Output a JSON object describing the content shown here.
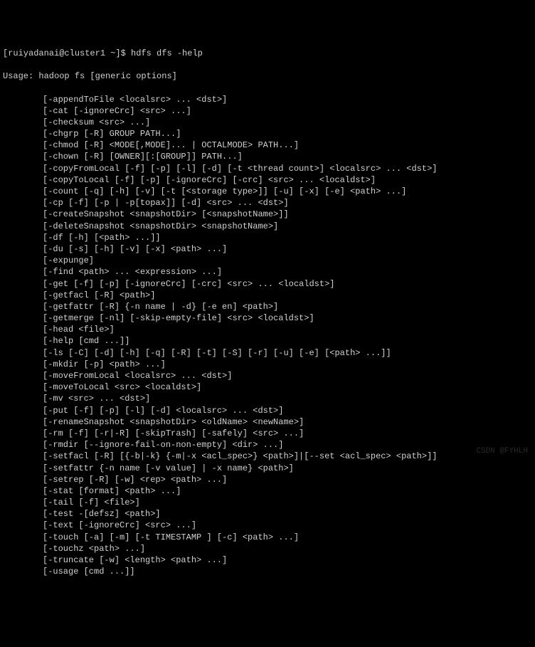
{
  "terminal": {
    "prompt_line": "[ruiyadanai@cluster1 ~]$ hdfs dfs -help",
    "usage_line": "Usage: hadoop fs [generic options]",
    "commands": [
      "[-appendToFile <localsrc> ... <dst>]",
      "[-cat [-ignoreCrc] <src> ...]",
      "[-checksum <src> ...]",
      "[-chgrp [-R] GROUP PATH...]",
      "[-chmod [-R] <MODE[,MODE]... | OCTALMODE> PATH...]",
      "[-chown [-R] [OWNER][:[GROUP]] PATH...]",
      "[-copyFromLocal [-f] [-p] [-l] [-d] [-t <thread count>] <localsrc> ... <dst>]",
      "[-copyToLocal [-f] [-p] [-ignoreCrc] [-crc] <src> ... <localdst>]",
      "[-count [-q] [-h] [-v] [-t [<storage type>]] [-u] [-x] [-e] <path> ...]",
      "[-cp [-f] [-p | -p[topax]] [-d] <src> ... <dst>]",
      "[-createSnapshot <snapshotDir> [<snapshotName>]]",
      "[-deleteSnapshot <snapshotDir> <snapshotName>]",
      "[-df [-h] [<path> ...]]",
      "[-du [-s] [-h] [-v] [-x] <path> ...]",
      "[-expunge]",
      "[-find <path> ... <expression> ...]",
      "[-get [-f] [-p] [-ignoreCrc] [-crc] <src> ... <localdst>]",
      "[-getfacl [-R] <path>]",
      "[-getfattr [-R] {-n name | -d} [-e en] <path>]",
      "[-getmerge [-nl] [-skip-empty-file] <src> <localdst>]",
      "[-head <file>]",
      "[-help [cmd ...]]",
      "[-ls [-C] [-d] [-h] [-q] [-R] [-t] [-S] [-r] [-u] [-e] [<path> ...]]",
      "[-mkdir [-p] <path> ...]",
      "[-moveFromLocal <localsrc> ... <dst>]",
      "[-moveToLocal <src> <localdst>]",
      "[-mv <src> ... <dst>]",
      "[-put [-f] [-p] [-l] [-d] <localsrc> ... <dst>]",
      "[-renameSnapshot <snapshotDir> <oldName> <newName>]",
      "[-rm [-f] [-r|-R] [-skipTrash] [-safely] <src> ...]",
      "[-rmdir [--ignore-fail-on-non-empty] <dir> ...]",
      "[-setfacl [-R] [{-b|-k} {-m|-x <acl_spec>} <path>]|[--set <acl_spec> <path>]]",
      "[-setfattr {-n name [-v value] | -x name} <path>]",
      "[-setrep [-R] [-w] <rep> <path> ...]",
      "[-stat [format] <path> ...]",
      "[-tail [-f] <file>]",
      "[-test -[defsz] <path>]",
      "[-text [-ignoreCrc] <src> ...]",
      "[-touch [-a] [-m] [-t TIMESTAMP ] [-c] <path> ...]",
      "[-touchz <path> ...]",
      "[-truncate [-w] <length> <path> ...]",
      "[-usage [cmd ...]]"
    ]
  },
  "watermark": "CSDN @FYHLH"
}
